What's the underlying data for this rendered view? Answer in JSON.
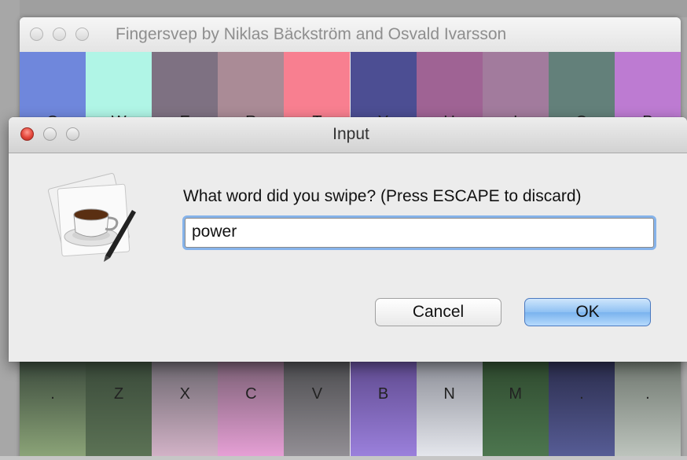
{
  "main_window": {
    "title": "Fingersvep by Niklas Bäckström and Osvald Ivarsson",
    "top_row": [
      {
        "label": "Q",
        "color": "#6f87dc"
      },
      {
        "label": "W",
        "color": "#b0f5e6"
      },
      {
        "label": "E",
        "color": "#7e7182"
      },
      {
        "label": "R",
        "color": "#aa8b96"
      },
      {
        "label": "T",
        "color": "#f87f90"
      },
      {
        "label": "Y",
        "color": "#4c4e93"
      },
      {
        "label": "U",
        "color": "#9f6394"
      },
      {
        "label": "I",
        "color": "#a27b9d"
      },
      {
        "label": "O",
        "color": "#63807a"
      },
      {
        "label": "P",
        "color": "#bd7bd2"
      }
    ],
    "bottom_row": [
      {
        "label": ".",
        "color_top": "#3c4b3d",
        "color_bottom": "#8ea77a"
      },
      {
        "label": "Z",
        "color_top": "#3a4a3a",
        "color_bottom": "#5d7456"
      },
      {
        "label": "X",
        "color_top": "#6d6870",
        "color_bottom": "#d6b5ca"
      },
      {
        "label": "C",
        "color_top": "#7a5f74",
        "color_bottom": "#eaa2d9"
      },
      {
        "label": "V",
        "color_top": "#4d4d50",
        "color_bottom": "#959197"
      },
      {
        "label": "B",
        "color_top": "#5f4a8f",
        "color_bottom": "#9d82df"
      },
      {
        "label": "N",
        "color_top": "#8d8f98",
        "color_bottom": "#e8eaf0"
      },
      {
        "label": "M",
        "color_top": "#2f4a2f",
        "color_bottom": "#4e7850"
      },
      {
        "label": ".",
        "color_top": "#2b2d4d",
        "color_bottom": "#585e98"
      },
      {
        "label": ".",
        "color_top": "#707870",
        "color_bottom": "#c0c7c0"
      }
    ]
  },
  "dialog": {
    "title": "Input",
    "icon": "java-coffee-cup-icon",
    "prompt": "What word did you swipe? (Press ESCAPE to discard)",
    "input_value": "power",
    "cancel_label": "Cancel",
    "ok_label": "OK",
    "accent_color": "#86b3ea"
  }
}
